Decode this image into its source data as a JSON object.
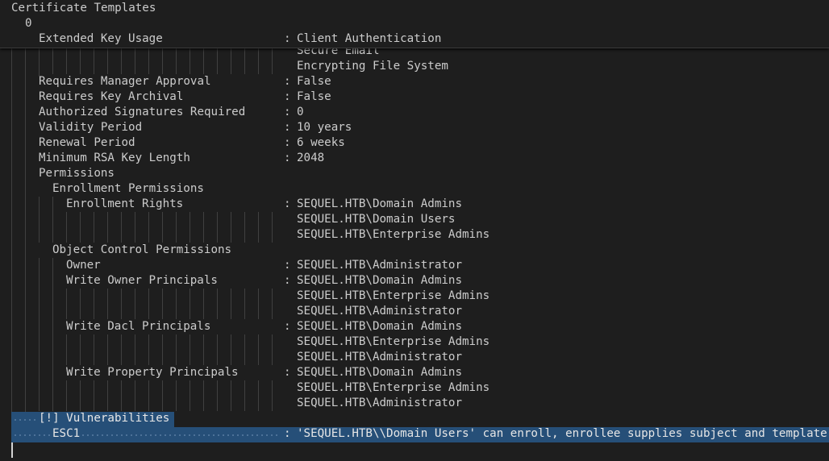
{
  "sticky": {
    "title": "Certificate Templates",
    "index": "0",
    "eku_key": "Extended Key Usage",
    "eku_value": "Client Authentication"
  },
  "eku_more": [
    "Secure Email",
    "Encrypting File System"
  ],
  "props": {
    "manager_approval_key": "Requires Manager Approval",
    "manager_approval_val": "False",
    "key_archival_key": "Requires Key Archival",
    "key_archival_val": "False",
    "auth_sigs_key": "Authorized Signatures Required",
    "auth_sigs_val": "0",
    "validity_key": "Validity Period",
    "validity_val": "10 years",
    "renewal_key": "Renewal Period",
    "renewal_val": "6 weeks",
    "min_rsa_key": "Minimum RSA Key Length",
    "min_rsa_val": "2048"
  },
  "permissions": {
    "heading": "Permissions",
    "enrollment_heading": "Enrollment Permissions",
    "enrollment_rights_key": "Enrollment Rights",
    "enrollment_rights": [
      "SEQUEL.HTB\\Domain Admins",
      "SEQUEL.HTB\\Domain Users",
      "SEQUEL.HTB\\Enterprise Admins"
    ],
    "object_control_heading": "Object Control Permissions",
    "owner_key": "Owner",
    "owner_val": "SEQUEL.HTB\\Administrator",
    "write_owner_key": "Write Owner Principals",
    "write_owner": [
      "SEQUEL.HTB\\Domain Admins",
      "SEQUEL.HTB\\Enterprise Admins",
      "SEQUEL.HTB\\Administrator"
    ],
    "write_dacl_key": "Write Dacl Principals",
    "write_dacl": [
      "SEQUEL.HTB\\Domain Admins",
      "SEQUEL.HTB\\Enterprise Admins",
      "SEQUEL.HTB\\Administrator"
    ],
    "write_property_key": "Write Property Principals",
    "write_property": [
      "SEQUEL.HTB\\Domain Admins",
      "SEQUEL.HTB\\Enterprise Admins",
      "SEQUEL.HTB\\Administrator"
    ]
  },
  "vulnerabilities": {
    "heading": "[!] Vulnerabilities",
    "esc_key": "ESC1",
    "esc_val": "'SEQUEL.HTB\\\\Domain Users' can enroll, enrollee supplies subject and template allows client authentication"
  },
  "colon": ":"
}
